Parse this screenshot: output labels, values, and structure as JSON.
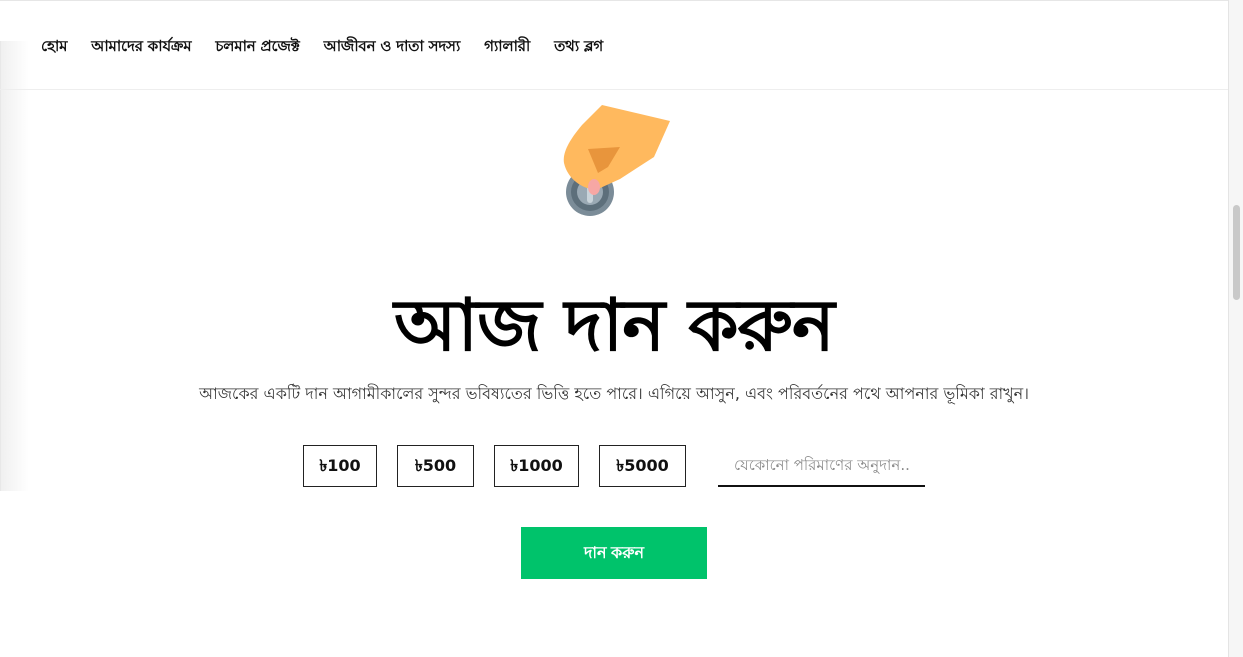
{
  "nav": {
    "items": [
      {
        "label": "হোম"
      },
      {
        "label": "আমাদের কার্যক্রম"
      },
      {
        "label": "চলমান প্রজেক্ট"
      },
      {
        "label": "আজীবন ও দাতা সদস্য"
      },
      {
        "label": "গ্যালারী"
      },
      {
        "label": "তথ্য ব্লগ"
      }
    ]
  },
  "hero": {
    "icon": "hand-coin-icon",
    "title": "আজ দান করুন",
    "subtitle": "আজকের একটি দান আগামীকালের সুন্দর ভবিষ্যতের ভিত্তি হতে পারে। এগিয়ে আসুন, এবং পরিবর্তনের পথে আপনার ভূমিকা রাখুন।"
  },
  "donation": {
    "amounts": [
      "৳100",
      "৳500",
      "৳1000",
      "৳5000"
    ],
    "custom_placeholder": "যেকোনো পরিমাণের অনুদান..",
    "custom_value": "",
    "submit_label": "দান করুন"
  },
  "colors": {
    "accent": "#00c36b",
    "hand": "#ffb95e",
    "coin": "#7b8c98"
  }
}
